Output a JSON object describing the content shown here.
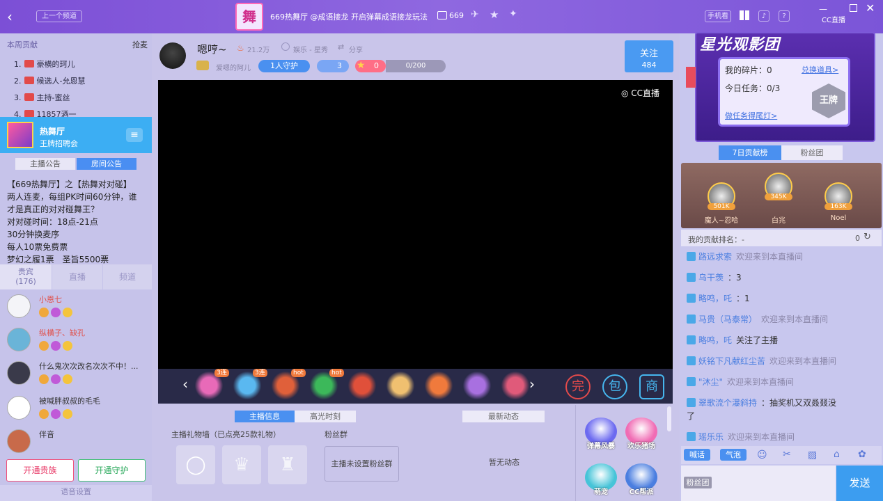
{
  "topbar": {
    "prev_channel": "上一个频道",
    "room_logo_char": "舞",
    "title": "669热舞厅 @成语接龙 开启弹幕成语接龙玩法",
    "room_number": "669",
    "mobile": "手机看",
    "help": "?",
    "brand": "CC直播"
  },
  "rank": {
    "tab_left": "本周贡献",
    "tab_right": "抢麦",
    "items": [
      {
        "num": "1.",
        "name": "豪横的珂儿"
      },
      {
        "num": "2.",
        "name": "候选人-允恩慧"
      },
      {
        "num": "3.",
        "name": "主持-蜜丝"
      },
      {
        "num": "4.",
        "name": "11857酒一"
      }
    ]
  },
  "channel": {
    "name": "热舞厅",
    "sub": "王牌招聘会"
  },
  "notice_tabs": {
    "anchor": "主播公告",
    "room": "房间公告"
  },
  "notice_lines": [
    "【669热舞厅】之【热舞对对碰】",
    "两人连麦，每组PK时间60分钟，谁",
    "才是真正的对对碰舞王？",
    "对对碰时间：18点-21点",
    "30分钟换麦序",
    "每人10票免费票",
    "梦幻之履1票　圣旨5500票"
  ],
  "audience_tabs": {
    "guest": "贵宾",
    "guest_count": "(176)",
    "live": "直播",
    "channel": "频道"
  },
  "audience": [
    {
      "name": "小恩七",
      "color": "#e0504a"
    },
    {
      "name": "纵横子、缺孔",
      "color": "#e0504a"
    },
    {
      "name": "什么鬼次次改名次次不中！...",
      "color": "#333"
    },
    {
      "name": "被喊胖叔叔的毛毛",
      "color": "#333"
    },
    {
      "name": "伴音",
      "color": "#333"
    }
  ],
  "bottom_left": {
    "btn_guard": "开通贵族",
    "btn_protect": "开通守护",
    "voice_settings": "语音设置"
  },
  "anchor": {
    "name": "嗯哼~",
    "heat": "21.2万",
    "category": "娱乐 - 星秀",
    "share": "分享",
    "fan_club": "爱嗯的阿儿",
    "guard": "1人守护",
    "fans_count": "3",
    "star_val": "0",
    "progress": "0/200",
    "progress_fraction": 0,
    "follow_label": "关注",
    "follow_count": "484"
  },
  "video": {
    "watermark": "CC直播"
  },
  "gift_badges": [
    "3连",
    "3连",
    "hot",
    "hot"
  ],
  "bottom_tabs": {
    "info": "主播信息",
    "highlights": "高光时刻",
    "news": "最新动态"
  },
  "info": {
    "gift_wall": "主播礼物墙（已点亮25款礼物）",
    "fan_group_title": "粉丝群",
    "fan_group_button": "主播未设置粉丝群",
    "no_news": "暂无动态"
  },
  "apps": [
    {
      "label": "弹幕风暴",
      "color": "#6c6af0"
    },
    {
      "label": "欢乐猪场",
      "color": "#f06cb4"
    },
    {
      "label": "萌宠",
      "color": "#46c4d8"
    },
    {
      "label": "CC帮派",
      "color": "#4a7ee0"
    }
  ],
  "promo": {
    "title": "星光观影团",
    "fragments": "我的碎片：0",
    "exchange": "兑换道具>",
    "task": "今日任务：0/3",
    "do_task": "做任务得尾灯>",
    "badge": "王牌"
  },
  "contrib_tabs": {
    "week": "7日贡献榜",
    "fans": "粉丝团"
  },
  "podium": [
    {
      "name": "魔人~忍哈",
      "value": "501K"
    },
    {
      "name": "白兆",
      "value": "345K"
    },
    {
      "name": "Noel",
      "value": "163K"
    }
  ],
  "my_rank": {
    "label": "我的贡献排名：",
    "value": "-",
    "count": "0"
  },
  "chat": [
    {
      "name": "路远求索",
      "text": "欢迎来到本直播间"
    },
    {
      "name": "乌干羡",
      "text": "：3"
    },
    {
      "name": "略鸣，吒",
      "text": "：1"
    },
    {
      "name": "马贵（马泰常）",
      "text": "欢迎来到本直播间"
    },
    {
      "name": "略鸣，吒",
      "text": "关注了主播"
    },
    {
      "name": "妖铭下凡献红尘苦",
      "text": "欢迎来到本直播间"
    },
    {
      "name": "\"沐尘\"",
      "text": "欢迎来到本直播间"
    },
    {
      "name": "翠歌流个瀑斜持",
      "text": "：抽奖机又双叒叕没"
    },
    {
      "name": "",
      "text": "了"
    },
    {
      "name": "瑶乐乐",
      "text": "欢迎来到本直播间"
    }
  ],
  "chat_tools": {
    "speak": "喊话",
    "bubble": "气泡"
  },
  "input": {
    "fan_club": "粉丝团",
    "send": "发送",
    "placeholder": ""
  },
  "colors": {
    "accent": "#8a5be0",
    "blue": "#3ca9f0",
    "send": "#3c9df0"
  }
}
